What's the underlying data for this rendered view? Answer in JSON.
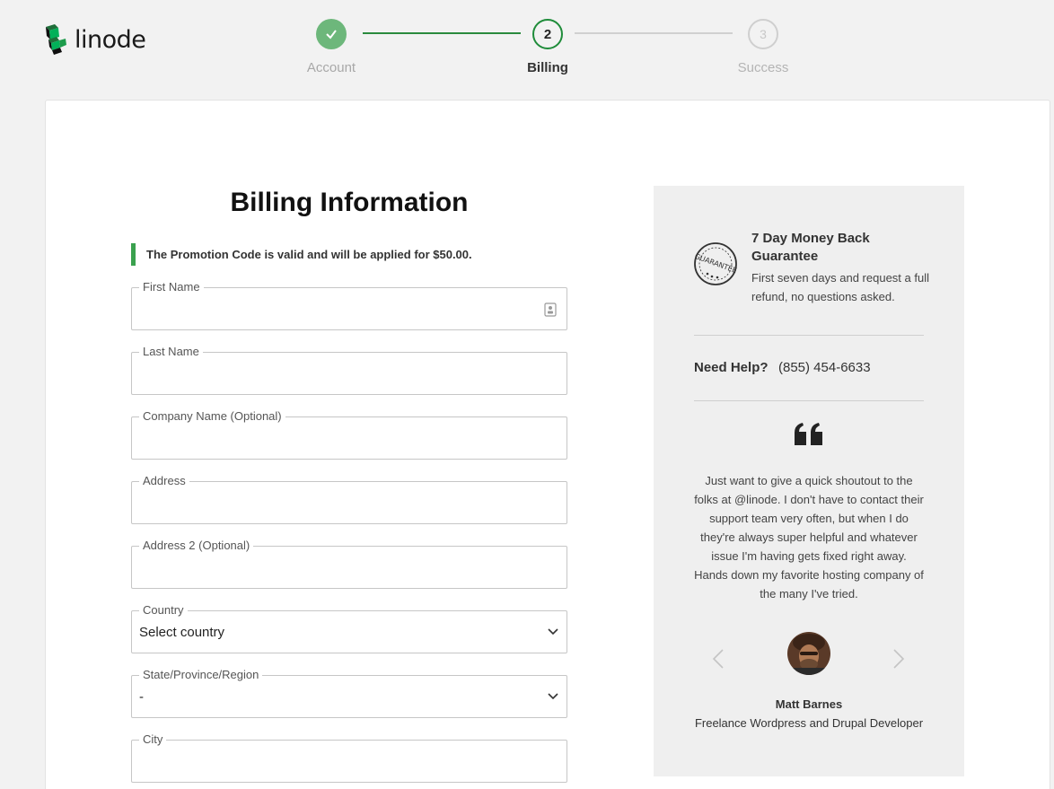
{
  "brand": {
    "name": "linode",
    "color": "#02b159"
  },
  "stepper": {
    "steps": [
      {
        "number": "1",
        "label": "Account",
        "state": "complete"
      },
      {
        "number": "2",
        "label": "Billing",
        "state": "active"
      },
      {
        "number": "3",
        "label": "Success",
        "state": "pending"
      }
    ]
  },
  "form": {
    "title": "Billing Information",
    "notice": "The Promotion Code is valid and will be applied for $50.00.",
    "fields": {
      "first_name": {
        "label": "First Name",
        "value": ""
      },
      "last_name": {
        "label": "Last Name",
        "value": ""
      },
      "company": {
        "label": "Company Name (Optional)",
        "value": ""
      },
      "address": {
        "label": "Address",
        "value": ""
      },
      "address2": {
        "label": "Address 2 (Optional)",
        "value": ""
      },
      "country": {
        "label": "Country",
        "value": "Select country"
      },
      "state": {
        "label": "State/Province/Region",
        "value": "-"
      },
      "city": {
        "label": "City",
        "value": ""
      }
    }
  },
  "sidebar": {
    "guarantee": {
      "badge_icon": "guarantee-badge-icon",
      "title": "7 Day Money Back Guarantee",
      "text": "First seven days and request a full refund, no questions asked."
    },
    "help": {
      "label": "Need Help?",
      "phone": "(855) 454-6633"
    },
    "testimonial": {
      "quote": "Just want to give a quick shoutout to the folks at @linode. I don't have to contact their support team very often, but when I do they're always super helpful and whatever issue I'm having gets fixed right away. Hands down my favorite hosting company of the many I've tried.",
      "author": "Matt Barnes",
      "role": "Freelance Wordpress and Drupal Developer"
    }
  }
}
